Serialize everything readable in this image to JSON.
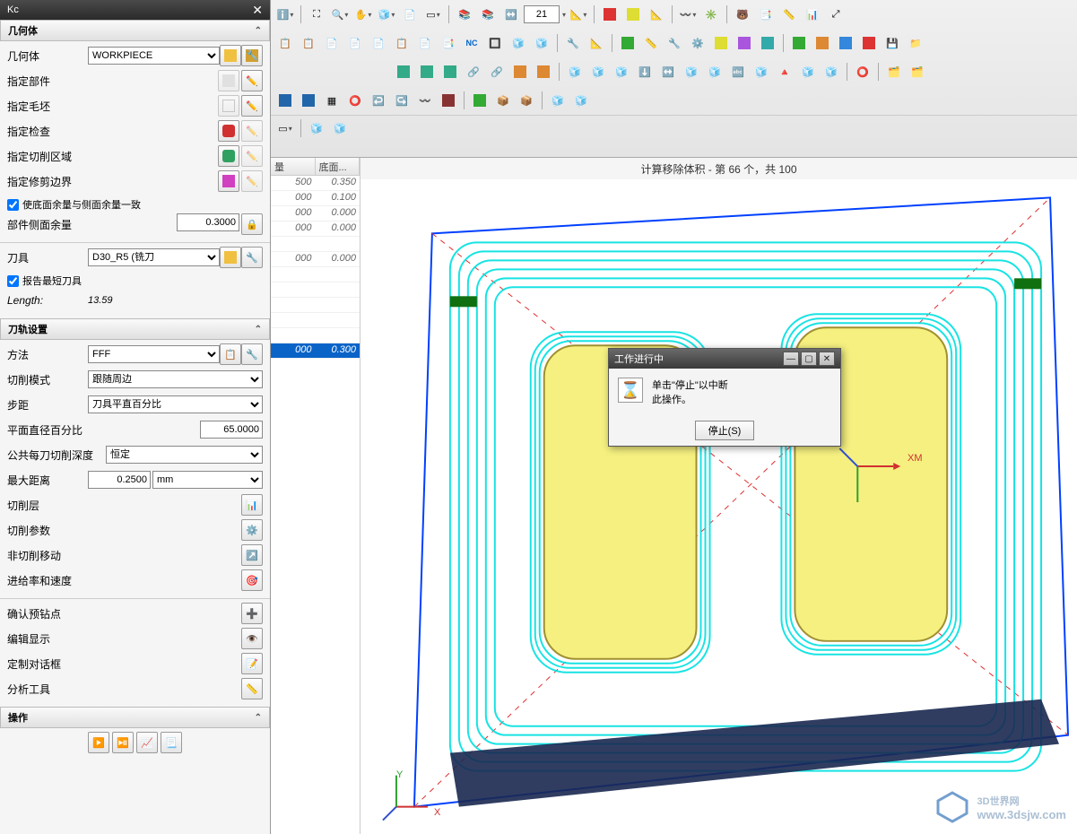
{
  "panel": {
    "title": "Kc",
    "geom_header": "几何体",
    "geom_label": "几何体",
    "geom_value": "WORKPIECE",
    "rows": {
      "part": "指定部件",
      "blank": "指定毛坯",
      "check": "指定检查",
      "cutarea": "指定切削区域",
      "trim": "指定修剪边界"
    },
    "stock_same": "使底面余量与侧面余量一致",
    "side_stock_label": "部件侧面余量",
    "side_stock_value": "0.3000",
    "tool_label": "刀具",
    "tool_value": "D30_R5 (铣刀",
    "report_short": "报告最短刀具",
    "length_label": "Length:",
    "length_value": "13.59",
    "path_header": "刀轨设置",
    "method_label": "方法",
    "method_value": "FFF",
    "cutmode_label": "切削模式",
    "cutmode_value": "跟随周边",
    "step_label": "步距",
    "step_value": "刀具平直百分比",
    "pct_label": "平面直径百分比",
    "pct_value": "65.0000",
    "depth_label": "公共每刀切削深度",
    "depth_value": "恒定",
    "maxdist_label": "最大距离",
    "maxdist_value": "0.2500",
    "maxdist_unit": "mm",
    "cutlevels": "切削层",
    "cutparams": "切削参数",
    "noncut": "非切削移动",
    "feeds": "进给率和速度",
    "predrill": "确认预钻点",
    "editdisp": "编辑显示",
    "customdlg": "定制对话框",
    "analysis": "分析工具",
    "op_header": "操作"
  },
  "toolbar": {
    "spin_value": "21"
  },
  "table": {
    "col1": "量",
    "col2": "底面...",
    "rows": [
      [
        "500",
        "0.350"
      ],
      [
        "000",
        "0.100"
      ],
      [
        "000",
        "0.000"
      ],
      [
        "000",
        "0.000"
      ],
      [
        "",
        ""
      ],
      [
        "000",
        "0.000"
      ],
      [
        "",
        ""
      ],
      [
        "",
        ""
      ],
      [
        "",
        ""
      ],
      [
        "",
        ""
      ],
      [
        "",
        ""
      ],
      [
        "000",
        "0.300"
      ]
    ],
    "highlight_index": 11
  },
  "viewport": {
    "status": "计算移除体积 - 第 66 个，共 100",
    "axis_xm": "XM",
    "axis_x": "X",
    "axis_y": "Y"
  },
  "dialog": {
    "title": "工作进行中",
    "line1": "单击\"停止\"以中断",
    "line2": "此操作。",
    "stop": "停止(S)"
  },
  "watermark": {
    "name": "3D世界网",
    "url": "www.3dsjw.com"
  }
}
